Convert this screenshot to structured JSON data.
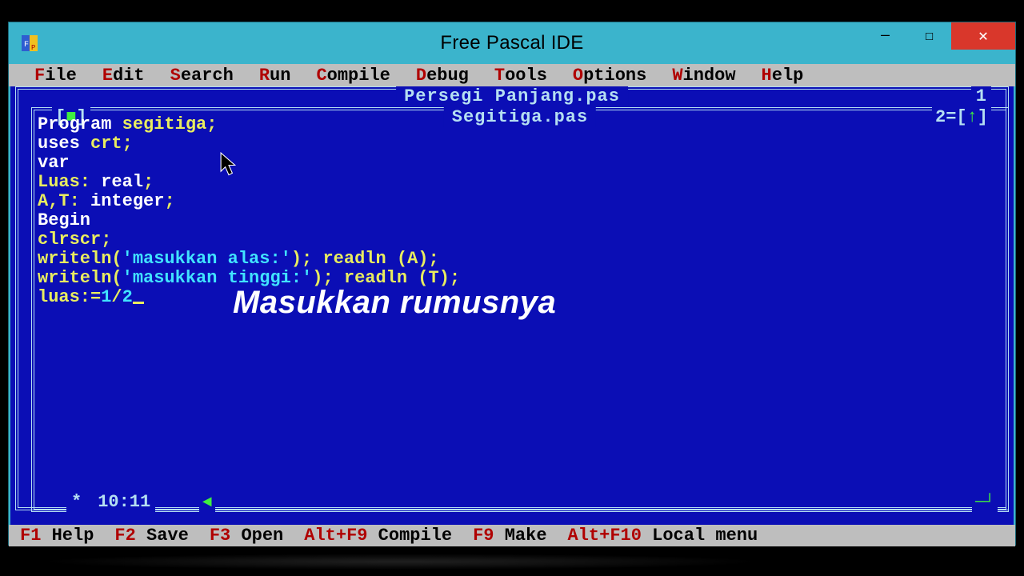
{
  "window": {
    "title": "Free Pascal IDE"
  },
  "menu": {
    "items": [
      {
        "hot": "F",
        "rest": "ile"
      },
      {
        "hot": "E",
        "rest": "dit"
      },
      {
        "hot": "S",
        "rest": "earch"
      },
      {
        "hot": "R",
        "rest": "un"
      },
      {
        "hot": "C",
        "rest": "ompile"
      },
      {
        "hot": "D",
        "rest": "ebug"
      },
      {
        "hot": "T",
        "rest": "ools"
      },
      {
        "hot": "O",
        "rest": "ptions"
      },
      {
        "hot": "W",
        "rest": "indow"
      },
      {
        "hot": "H",
        "rest": "elp"
      }
    ]
  },
  "editor": {
    "back_window": {
      "title": "Persegi Panjang.pas",
      "number": "1"
    },
    "front_window": {
      "title": "Segitiga.pas",
      "number": "2",
      "close_glyph": "[■]",
      "max_glyph": "=[↑]"
    },
    "position": "10:11",
    "modified": "*",
    "code": {
      "l1_a": "Program ",
      "l1_b": "segitiga;",
      "l2_a": "uses ",
      "l2_b": "crt;",
      "l3": "var",
      "l4_a": " Luas: ",
      "l4_b": "real",
      "l4_c": ";",
      "l5_a": " A,T: ",
      "l5_b": "integer",
      "l5_c": ";",
      "l6": "Begin",
      "l7": " clrscr;",
      "l8_a": " writeln(",
      "l8_b": "'masukkan alas:'",
      "l8_c": "); readln (A);",
      "l9_a": " writeln(",
      "l9_b": "'masukkan tinggi:'",
      "l9_c": "); readln (T);",
      "l10_a": " luas:=",
      "l10_b": "1",
      "l10_c": "/",
      "l10_d": "2"
    }
  },
  "overlay": {
    "caption": "Masukkan rumusnya"
  },
  "status": {
    "items": [
      {
        "key": "F1",
        "txt": " Help"
      },
      {
        "key": "F2",
        "txt": " Save"
      },
      {
        "key": "F3",
        "txt": " Open"
      },
      {
        "key": "Alt+F9",
        "txt": " Compile"
      },
      {
        "key": "F9",
        "txt": " Make"
      },
      {
        "key": "Alt+F10",
        "txt": " Local menu"
      }
    ]
  }
}
